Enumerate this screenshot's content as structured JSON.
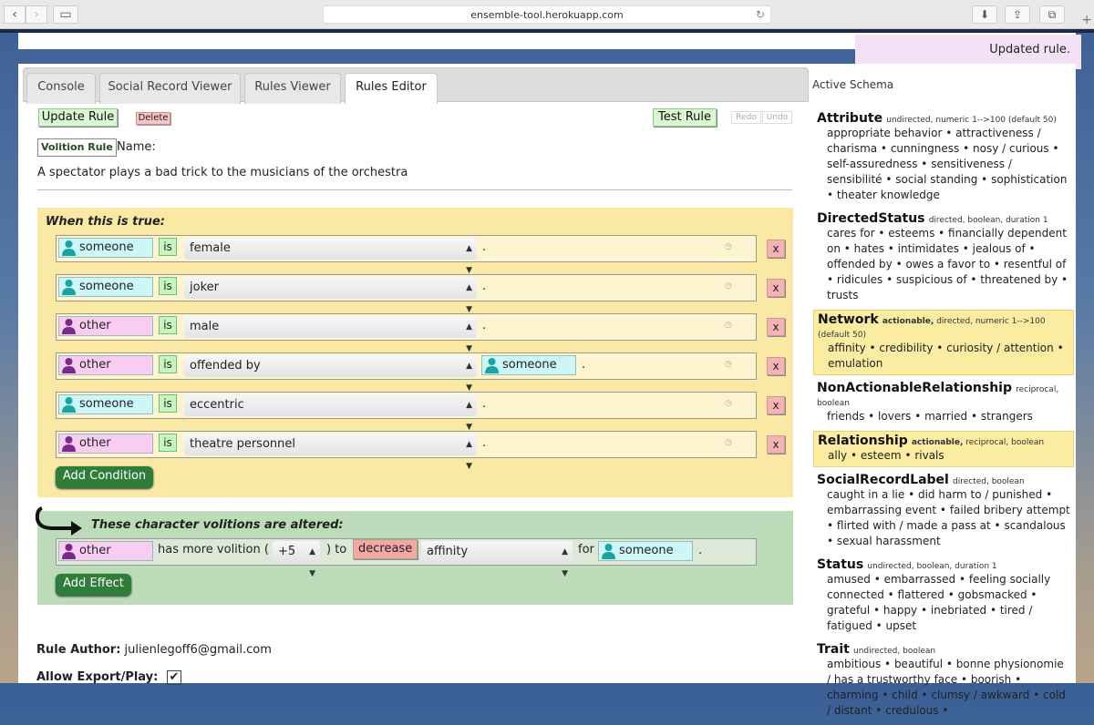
{
  "browser": {
    "url": "ensemble-tool.herokuapp.com"
  },
  "notification": "Updated rule.",
  "tabs": [
    {
      "label": "Console"
    },
    {
      "label": "Social Record Viewer"
    },
    {
      "label": "Rules Viewer"
    },
    {
      "label": "Rules Editor"
    }
  ],
  "toolbar": {
    "update_label": "Update Rule",
    "delete_label": "Delete",
    "test_label": "Test Rule",
    "redo_label": "Redo",
    "undo_label": "Undo"
  },
  "rule": {
    "type": "Volition Rule",
    "name_label": "Name:",
    "name": "A spectator plays a bad trick to the musicians of the orchestra"
  },
  "conditions": {
    "title": "When this is true:",
    "add_label": "Add Condition",
    "remove_label": "x",
    "rows": [
      {
        "char": "someone",
        "is": "is",
        "pred": "female",
        "dot": "."
      },
      {
        "char": "someone",
        "is": "is",
        "pred": "joker",
        "dot": "."
      },
      {
        "char": "other",
        "is": "is",
        "pred": "male",
        "dot": "."
      },
      {
        "char": "other",
        "is": "is",
        "pred": "offended by",
        "target": "someone",
        "dot": "."
      },
      {
        "char": "someone",
        "is": "is",
        "pred": "eccentric",
        "dot": "."
      },
      {
        "char": "other",
        "is": "is",
        "pred": "theatre personnel",
        "dot": "."
      }
    ]
  },
  "effects": {
    "title": "These character volitions are altered:",
    "add_label": "Add Effect",
    "row": {
      "char": "other",
      "text1": "has more volition (",
      "amount": "+5",
      "text2": ") to",
      "direction": "decrease",
      "pred": "affinity",
      "for_label": "for",
      "target": "someone",
      "dot": "."
    }
  },
  "author": {
    "label": "Rule Author:",
    "value": "julienlegoff6@gmail.com"
  },
  "allow": {
    "label": "Allow Export/Play:",
    "checked": "✔"
  },
  "schema": {
    "title": "Active Schema",
    "blocks": [
      {
        "name": "Attribute",
        "meta": "undirected, numeric 1-->100 (default 50)",
        "items": "appropriate behavior • attractiveness / charisma • cunningness • nosy / curious • self-assuredness • sensitiveness / sensibilité • social standing • sophistication • theater knowledge"
      },
      {
        "name": "DirectedStatus",
        "meta": "directed, boolean, duration 1",
        "items": "cares for • esteems • financially dependent on • hates • intimidates • jealous of • offended by • owes a favor to • resentful of • ridicules • suspicious of • threatened by • trusts"
      },
      {
        "name": "Network",
        "actionable": "actionable,",
        "meta": "directed, numeric 1-->100 (default 50)",
        "items": "affinity • credibility • curiosity / attention • emulation"
      },
      {
        "name": "NonActionableRelationship",
        "meta": "reciprocal, boolean",
        "items": "friends • lovers • married • strangers"
      },
      {
        "name": "Relationship",
        "actionable": "actionable,",
        "meta": "reciprocal, boolean",
        "items": "ally • esteem • rivals"
      },
      {
        "name": "SocialRecordLabel",
        "meta": "directed, boolean",
        "items": "caught in a lie • did harm to / punished • embarrassing event • failed bribery attempt • flirted with / made a pass at • scandalous • sexual harassment"
      },
      {
        "name": "Status",
        "meta": "undirected, boolean, duration 1",
        "items": "amused • embarrassed • feeling socially connected • flattered • gobsmacked • grateful • happy • inebriated • tired / fatigued • upset"
      },
      {
        "name": "Trait",
        "meta": "undirected, boolean",
        "items": "ambitious • beautiful • bonne physionomie / has a trustworthy face • boorish • charming • child • clumsy / awkward • cold / distant • credulous •"
      }
    ]
  },
  "colors": {
    "condition_panel": "#fae9a4",
    "effect_panel": "#bcdcb9",
    "someone_icon": "#1aa3a3",
    "other_icon": "#7a2a8a",
    "schema_highlight": "#faeca0"
  }
}
